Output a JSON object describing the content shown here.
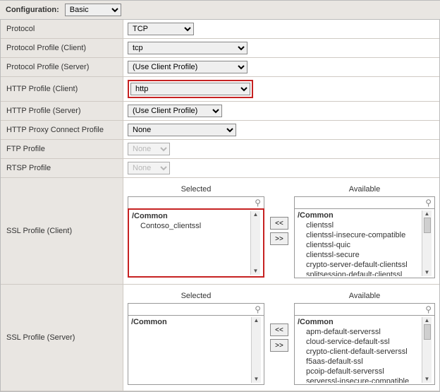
{
  "header": {
    "config_label": "Configuration:",
    "config_value": "Basic"
  },
  "rows": {
    "protocol": {
      "label": "Protocol",
      "value": "TCP"
    },
    "protoProfClient": {
      "label": "Protocol Profile (Client)",
      "value": "tcp"
    },
    "protoProfServer": {
      "label": "Protocol Profile (Server)",
      "value": "(Use Client Profile)"
    },
    "httpProfClient": {
      "label": "HTTP Profile (Client)",
      "value": "http"
    },
    "httpProfServer": {
      "label": "HTTP Profile (Server)",
      "value": "(Use Client Profile)"
    },
    "httpProxy": {
      "label": "HTTP Proxy Connect Profile",
      "value": "None"
    },
    "ftp": {
      "label": "FTP Profile",
      "value": "None"
    },
    "rtsp": {
      "label": "RTSP Profile",
      "value": "None"
    }
  },
  "ssl": {
    "selected_header": "Selected",
    "available_header": "Available",
    "move_left": "<<",
    "move_right": ">>",
    "common": "/Common",
    "client": {
      "label": "SSL Profile (Client)",
      "selected": [
        "Contoso_clientssl"
      ],
      "available": [
        "clientssl",
        "clientssl-insecure-compatible",
        "clientssl-quic",
        "clientssl-secure",
        "crypto-server-default-clientssl",
        "splitsession-default-clientssl"
      ]
    },
    "server": {
      "label": "SSL Profile (Server)",
      "selected": [],
      "available": [
        "apm-default-serverssl",
        "cloud-service-default-ssl",
        "crypto-client-default-serverssl",
        "f5aas-default-ssl",
        "pcoip-default-serverssl",
        "serverssl-insecure-compatible"
      ]
    }
  }
}
